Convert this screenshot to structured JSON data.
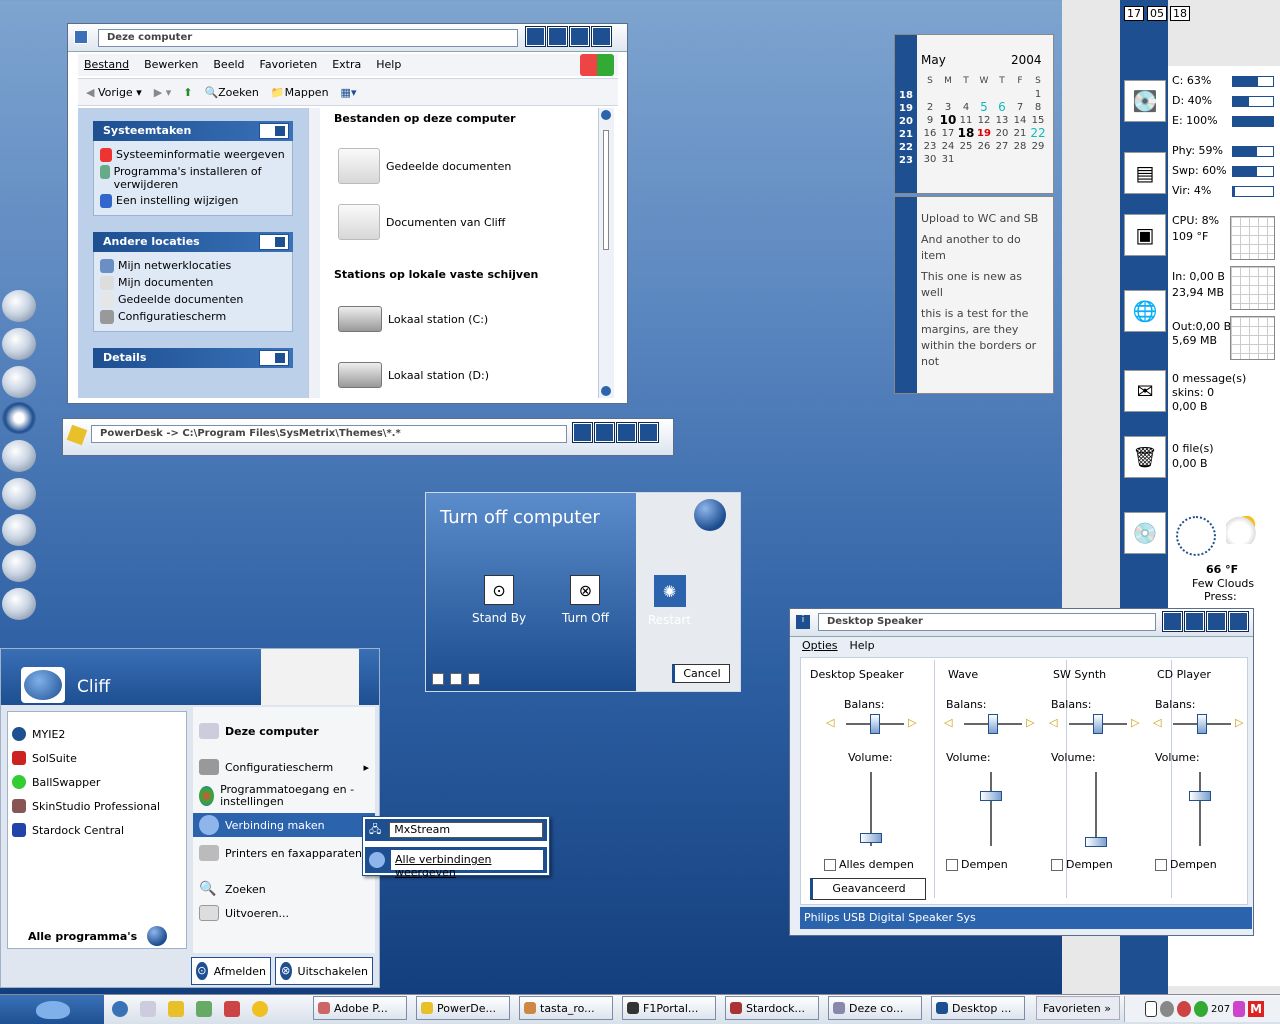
{
  "explorer": {
    "title": "Deze computer",
    "menu": [
      "Bestand",
      "Bewerken",
      "Beeld",
      "Favorieten",
      "Extra",
      "Help"
    ],
    "toolbar": {
      "back": "Vorige",
      "search": "Zoeken",
      "folders": "Mappen"
    },
    "panel1": {
      "title": "Systeemtaken",
      "items": [
        "Systeeminformatie weergeven",
        "Programma's installeren of verwijderen",
        "Een instelling wijzigen"
      ]
    },
    "panel2": {
      "title": "Andere locaties",
      "items": [
        "Mijn netwerklocaties",
        "Mijn documenten",
        "Gedeelde documenten",
        "Configuratiescherm"
      ]
    },
    "panel3": {
      "title": "Details"
    },
    "section1": "Bestanden op deze computer",
    "files": [
      "Gedeelde documenten",
      "Documenten van Cliff"
    ],
    "section2": "Stations op lokale vaste schijven",
    "drives": [
      "Lokaal station (C:)",
      "Lokaal station (D:)"
    ]
  },
  "powerdesk": {
    "path": "PowerDesk -> C:\\Program Files\\SysMetrix\\Themes\\*.*"
  },
  "calendar": {
    "month": "May",
    "year": "2004",
    "days": [
      "S",
      "M",
      "T",
      "W",
      "T",
      "F",
      "S"
    ],
    "weeks": [
      "18",
      "19",
      "20",
      "21",
      "22",
      "23"
    ],
    "rows": [
      [
        "",
        "",
        "",
        "",
        "",
        "",
        "1"
      ],
      [
        "2",
        "3",
        "4",
        "5",
        "6",
        "7",
        "8"
      ],
      [
        "9",
        "10",
        "11",
        "12",
        "13",
        "14",
        "15"
      ],
      [
        "16",
        "17",
        "18",
        "19",
        "20",
        "21",
        "22"
      ],
      [
        "23",
        "24",
        "25",
        "26",
        "27",
        "28",
        "29"
      ],
      [
        "30",
        "31",
        "",
        "",
        "",
        "",
        ""
      ]
    ]
  },
  "notes": [
    "Upload to WC and SB",
    "And another to do item",
    "This one is new as well",
    "this is a test for the margins, are they within the borders or not"
  ],
  "shutdown": {
    "title": "Turn off computer",
    "standby": "Stand By",
    "turnoff": "Turn Off",
    "restart": "Restart",
    "cancel": "Cancel"
  },
  "startmenu": {
    "user": "Cliff",
    "pinned": [
      "MYIE2",
      "SolSuite",
      "BallSwapper",
      "SkinStudio Professional",
      "Stardock Central"
    ],
    "all_programs": "Alle programma's",
    "right": [
      "Deze computer",
      "Configuratiescherm",
      "Programmatoegang en -instellingen",
      "Verbinding maken",
      "Printers en faxapparaten",
      "Zoeken",
      "Uitvoeren..."
    ],
    "logoff": "Afmelden",
    "shutdown": "Uitschakelen"
  },
  "submenu": [
    "MxStream",
    "Alle verbindingen weergeven"
  ],
  "mixer": {
    "title": "Desktop Speaker",
    "menu": [
      "Opties",
      "Help"
    ],
    "columns": [
      "Desktop Speaker",
      "Wave",
      "SW Synth",
      "CD Player"
    ],
    "balance": "Balans:",
    "volume": "Volume:",
    "mute_all": "Alles dempen",
    "mute": "Dempen",
    "advanced": "Geavanceerd",
    "status": "Philips USB Digital Speaker Sys",
    "balance_levels": [
      0.5,
      0.5,
      0.5,
      0.5
    ],
    "volume_levels": [
      0.1,
      0.7,
      0.05,
      0.7
    ]
  },
  "sysmetrix": {
    "date": [
      "17",
      "05",
      "18"
    ],
    "drives": [
      {
        "label": "C: 63%",
        "value": 63
      },
      {
        "label": "D: 40%",
        "value": 40
      },
      {
        "label": "E: 100%",
        "value": 100
      }
    ],
    "memory": [
      {
        "label": "Phy: 59%",
        "value": 59
      },
      {
        "label": "Swp: 60%",
        "value": 60
      },
      {
        "label": "Vir: 4%",
        "value": 4
      }
    ],
    "cpu": "CPU: 8%",
    "temp": "109 °F",
    "net_in": "In: 0,00 B",
    "net_in2": "23,94 MB",
    "net_out": "Out:0,00 B",
    "net_out2": "5,69 MB",
    "mail": "0 message(s)",
    "skins": "skins: 0",
    "mail_size": "0,00 B",
    "files": "0 file(s)",
    "files_size": "0,00 B",
    "weather_temp": "66 °F",
    "weather_desc": "Few Clouds",
    "weather_press": "Press:"
  },
  "taskbar": {
    "tasks": [
      "Adobe P...",
      "PowerDe...",
      "tasta_ro...",
      "F1Portal...",
      "Stardock...",
      "Deze co...",
      "Desktop ..."
    ],
    "favorites": "Favorieten",
    "tray": "207"
  }
}
